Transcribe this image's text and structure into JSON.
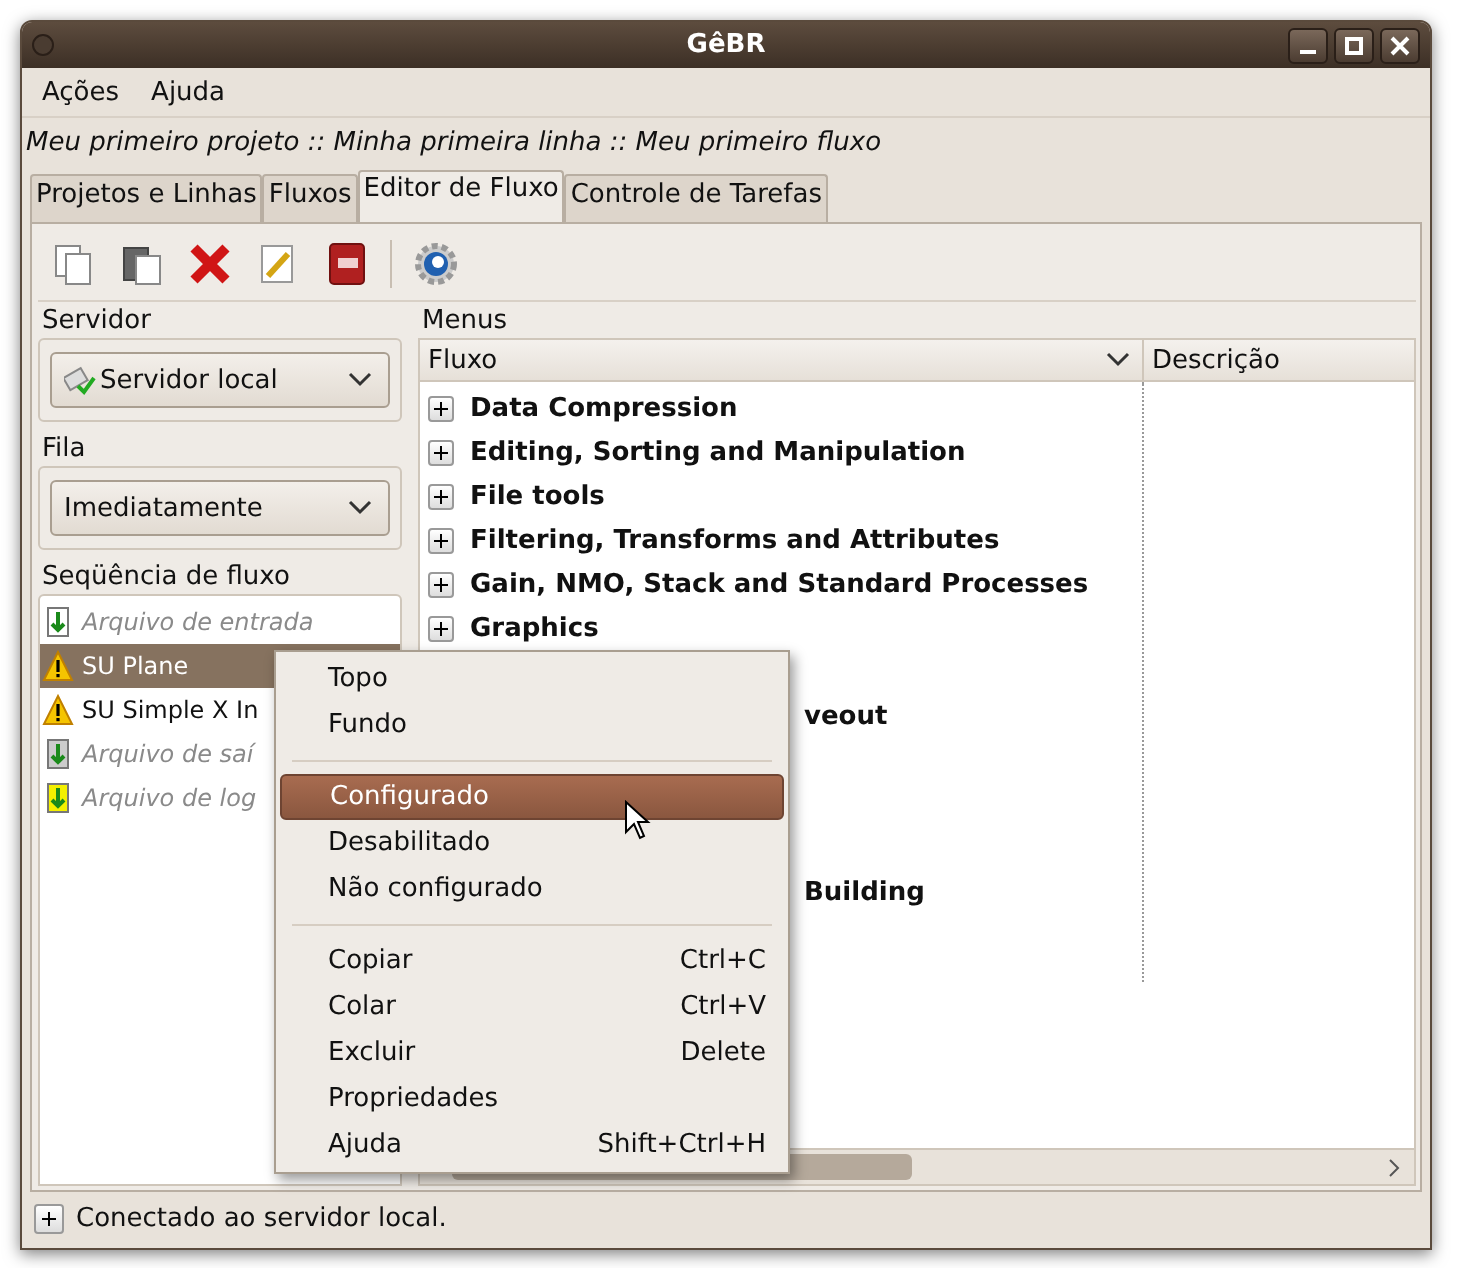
{
  "window": {
    "title": "GêBR"
  },
  "menubar": [
    {
      "label": "Ações"
    },
    {
      "label": "Ajuda"
    }
  ],
  "breadcrumb": "Meu primeiro projeto :: Minha primeira linha :: Meu primeiro fluxo",
  "tabs": [
    {
      "label": "Projetos e Linhas",
      "selected": false
    },
    {
      "label": "Fluxos",
      "selected": false
    },
    {
      "label": "Editor de Fluxo",
      "selected": true
    },
    {
      "label": "Controle de Tarefas",
      "selected": false
    }
  ],
  "toolbar": [
    {
      "kind": "copy"
    },
    {
      "kind": "paste"
    },
    {
      "kind": "delete"
    },
    {
      "kind": "edit"
    },
    {
      "kind": "dictionary"
    },
    {
      "kind": "separator"
    },
    {
      "kind": "gear"
    }
  ],
  "server": {
    "title": "Servidor",
    "value": "Servidor local"
  },
  "queue": {
    "title": "Fila",
    "value": "Imediatamente"
  },
  "sequence": {
    "title": "Seqüência de fluxo",
    "items": [
      {
        "label": "Arquivo de entrada",
        "kind": "input",
        "selected": false
      },
      {
        "label": "SU Plane",
        "kind": "warning",
        "selected": true
      },
      {
        "label": "SU Simple X In",
        "kind": "warning",
        "selected": false
      },
      {
        "label": "Arquivo de saí",
        "kind": "output",
        "selected": false
      },
      {
        "label": "Arquivo de log",
        "kind": "log",
        "selected": false
      }
    ]
  },
  "menus": {
    "title": "Menus",
    "columns": [
      "Fluxo",
      "Descrição"
    ],
    "rows": [
      {
        "kind": "full",
        "label": "Data Compression",
        "expanded": false
      },
      {
        "kind": "full",
        "label": "Editing, Sorting and Manipulation",
        "expanded": false
      },
      {
        "kind": "full",
        "label": "File tools",
        "expanded": false
      },
      {
        "kind": "full",
        "label": "Filtering, Transforms and Attributes",
        "expanded": false
      },
      {
        "kind": "full",
        "label": "Gain, NMO, Stack and Standard Processes",
        "expanded": false
      },
      {
        "kind": "full",
        "label": "Graphics",
        "expanded": false
      },
      {
        "kind": "covered"
      },
      {
        "kind": "partial",
        "label": "veout"
      },
      {
        "kind": "covered"
      },
      {
        "kind": "covered"
      },
      {
        "kind": "covered"
      },
      {
        "kind": "partial",
        "label": "Building"
      }
    ]
  },
  "context_menu": {
    "items": [
      {
        "kind": "item",
        "label": "Topo",
        "selected": false
      },
      {
        "kind": "item",
        "label": "Fundo",
        "selected": false
      },
      {
        "kind": "separator"
      },
      {
        "kind": "item",
        "label": "Configurado",
        "selected": true
      },
      {
        "kind": "item",
        "label": "Desabilitado",
        "selected": false
      },
      {
        "kind": "item",
        "label": "Não configurado",
        "selected": false
      },
      {
        "kind": "separator"
      },
      {
        "kind": "item",
        "label": "Copiar",
        "shortcut": "Ctrl+C",
        "selected": false
      },
      {
        "kind": "item",
        "label": "Colar",
        "shortcut": "Ctrl+V",
        "selected": false
      },
      {
        "kind": "item",
        "label": "Excluir",
        "shortcut": "Delete",
        "selected": false
      },
      {
        "kind": "item",
        "label": "Propriedades",
        "selected": false
      },
      {
        "kind": "item",
        "label": "Ajuda",
        "shortcut": "Shift+Ctrl+H",
        "selected": false
      }
    ]
  },
  "status_bar": {
    "text": "Conectado ao servidor local.",
    "expanded": false
  }
}
